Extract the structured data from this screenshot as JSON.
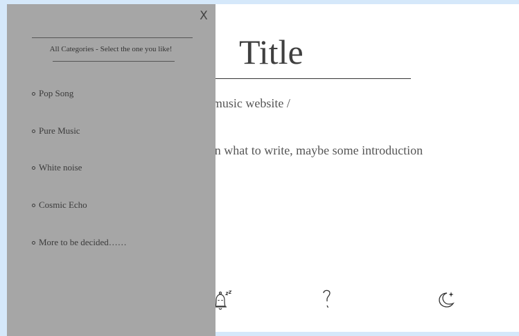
{
  "main": {
    "title": "Title",
    "subtitle": "Hongxuan & Yuxin’s music website  /",
    "intro": "Still haven't decided on what to write, maybe some introduction",
    "icons": [
      {
        "name": "sleep-bell-icon"
      },
      {
        "name": "question-icon"
      },
      {
        "name": "moon-star-icon"
      }
    ]
  },
  "panel": {
    "close_label": "X",
    "header": "All Categories -  Select the one you like!",
    "items": [
      {
        "label": "Pop Song"
      },
      {
        "label": "Pure Music"
      },
      {
        "label": "White noise"
      },
      {
        "label": "Cosmic Echo"
      },
      {
        "label": "More to be decided……"
      }
    ]
  },
  "colors": {
    "background": "#d5e8fa",
    "panel": "#a6a6a6",
    "page": "#ffffff",
    "text": "#3b3b3b"
  }
}
